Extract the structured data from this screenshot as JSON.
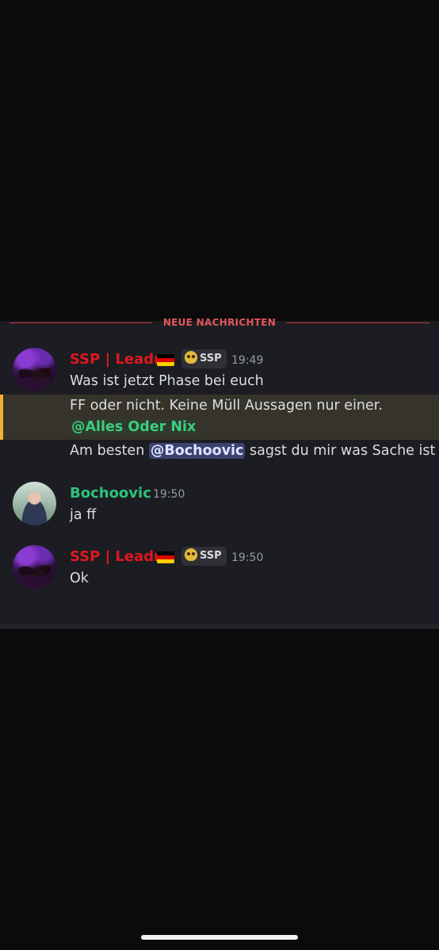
{
  "divider": {
    "label": "NEUE NACHRICHTEN"
  },
  "messages": [
    {
      "author": "SSP | Leadr",
      "flag": "german-flag",
      "tag": "SSP",
      "time": "19:49",
      "lines": {
        "line1": "Was ist jetzt Phase bei euch",
        "line2": "FF oder nicht. Keine Müll Aussagen nur einer.",
        "line3_mention": "@Alles Oder Nix",
        "line4_prefix": "Am besten",
        "line4_mention": "@Bochoovic",
        "line4_suffix": "sagst du mir was Sache ist"
      }
    },
    {
      "author": "Bochoovic",
      "time": "19:50",
      "text": "ja ff"
    },
    {
      "author": "SSP | Leadr",
      "flag": "german-flag",
      "tag": "SSP",
      "time": "19:50",
      "text": "Ok"
    }
  ],
  "colors": {
    "author_red": "#e0171f",
    "author_green": "#2ec27a",
    "mention_highlight": "#f0b232",
    "background": "#1c1d22"
  }
}
